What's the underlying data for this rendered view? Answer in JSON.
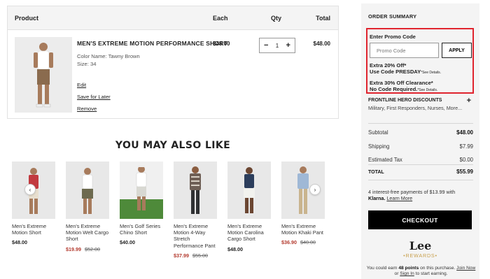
{
  "cart": {
    "headers": {
      "product": "Product",
      "each": "Each",
      "qty": "Qty",
      "total": "Total"
    },
    "item": {
      "name": "MEN'S EXTREME MOTION PERFORMANCE SHORT",
      "color_label": "Color Name: Tawny Brown",
      "size_label": "Size: 34",
      "each": "$48.00",
      "total": "$48.00",
      "qty": "1",
      "minus": "−",
      "plus": "+",
      "edit": "Edit",
      "save_for_later": "Save for Later",
      "remove": "Remove"
    }
  },
  "recs": {
    "title": "YOU MAY ALSO LIKE",
    "items": [
      {
        "name": "Men's Extreme Motion Short",
        "price": "$48.00",
        "sale": "",
        "was": ""
      },
      {
        "name": "Men's Extreme Motion Welt Cargo Short",
        "price": "",
        "sale": "$19.99",
        "was": "$52.00"
      },
      {
        "name": "Men's Golf Series Chino Short",
        "price": "$40.00",
        "sale": "",
        "was": ""
      },
      {
        "name": "Men's Extreme Motion 4-Way Stretch Performance Pant",
        "price": "",
        "sale": "$37.99",
        "was": "$55.00"
      },
      {
        "name": "Men's Extreme Motion Carolina Cargo Short",
        "price": "$48.00",
        "sale": "",
        "was": ""
      },
      {
        "name": "Men's Extreme Motion Khaki Pant",
        "price": "",
        "sale": "$36.90",
        "was": "$40.00"
      }
    ],
    "prev": "‹",
    "next": "›"
  },
  "summary": {
    "title": "ORDER SUMMARY",
    "promo_label": "Enter Promo Code",
    "promo_placeholder": "Promo Code",
    "apply": "APPLY",
    "offer1_l1": "Extra 20% Off*",
    "offer1_l2": "Use Code PRESDAY",
    "offer1_see": "*See Details.",
    "offer2_l1": "Extra 30% Off Clearance*",
    "offer2_l2": "No Code Required.",
    "offer2_see": "*See Details.",
    "frontline_title": "FRONTLINE HERO DISCOUNTS",
    "frontline_plus": "+",
    "frontline_desc": "Military, First Responders, Nurses, More...",
    "subtotal_label": "Subtotal",
    "subtotal": "$48.00",
    "shipping_label": "Shipping",
    "shipping": "$7.99",
    "tax_label": "Estimated Tax",
    "tax": "$0.00",
    "total_label": "TOTAL",
    "total": "$55.99",
    "klarna_text": "4 interest-free payments of $13.99 with",
    "klarna_brand": "Klarna.",
    "klarna_link": "Learn More",
    "checkout": "CHECKOUT",
    "lee_logo": "Lee",
    "lee_rewards": "•REWARDS•",
    "earn_pre": "You could earn",
    "earn_points": "48 points",
    "earn_mid": "on this purchase.",
    "join": "Join Now",
    "or": "or",
    "signin": "Sign In",
    "earn_post": "to start earning."
  }
}
